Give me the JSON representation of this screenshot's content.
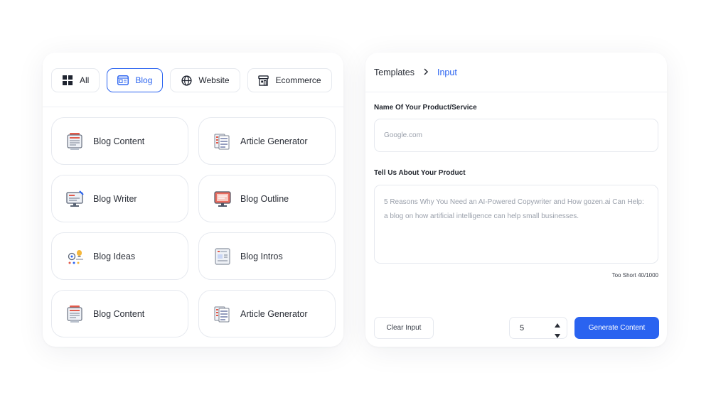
{
  "tabs": [
    {
      "label": "All",
      "icon": "grid-icon",
      "active": false
    },
    {
      "label": "Blog",
      "icon": "blog-icon",
      "active": true
    },
    {
      "label": "Website",
      "icon": "globe-icon",
      "active": false
    },
    {
      "label": "Ecommerce",
      "icon": "store-icon",
      "active": false
    }
  ],
  "templates": [
    {
      "label": "Blog Content",
      "icon": "blog-content-icon"
    },
    {
      "label": "Article Generator",
      "icon": "article-generator-icon"
    },
    {
      "label": "Blog Writer",
      "icon": "blog-writer-icon"
    },
    {
      "label": "Blog Outline",
      "icon": "blog-outline-icon"
    },
    {
      "label": "Blog Ideas",
      "icon": "blog-ideas-icon"
    },
    {
      "label": "Blog Intros",
      "icon": "blog-intros-icon"
    },
    {
      "label": "Blog Content",
      "icon": "blog-content-icon"
    },
    {
      "label": "Article Generator",
      "icon": "article-generator-icon"
    }
  ],
  "breadcrumb": {
    "parent": "Templates",
    "current": "Input"
  },
  "form": {
    "product_label": "Name Of Your Product/Service",
    "product_placeholder": "Google.com",
    "about_label": "Tell Us About Your Product",
    "about_placeholder": "5 Reasons Why You Need an AI-Powered Copywriter and How gozen.ai Can Help: a blog on how artificial intelligence can help small businesses.",
    "counter": "Too Short 40/1000",
    "clear_label": "Clear Input",
    "quantity": "5",
    "generate_label": "Generate Content"
  },
  "colors": {
    "accent": "#2a63f0",
    "border": "#e6e9ef",
    "text": "#2a2e37"
  }
}
